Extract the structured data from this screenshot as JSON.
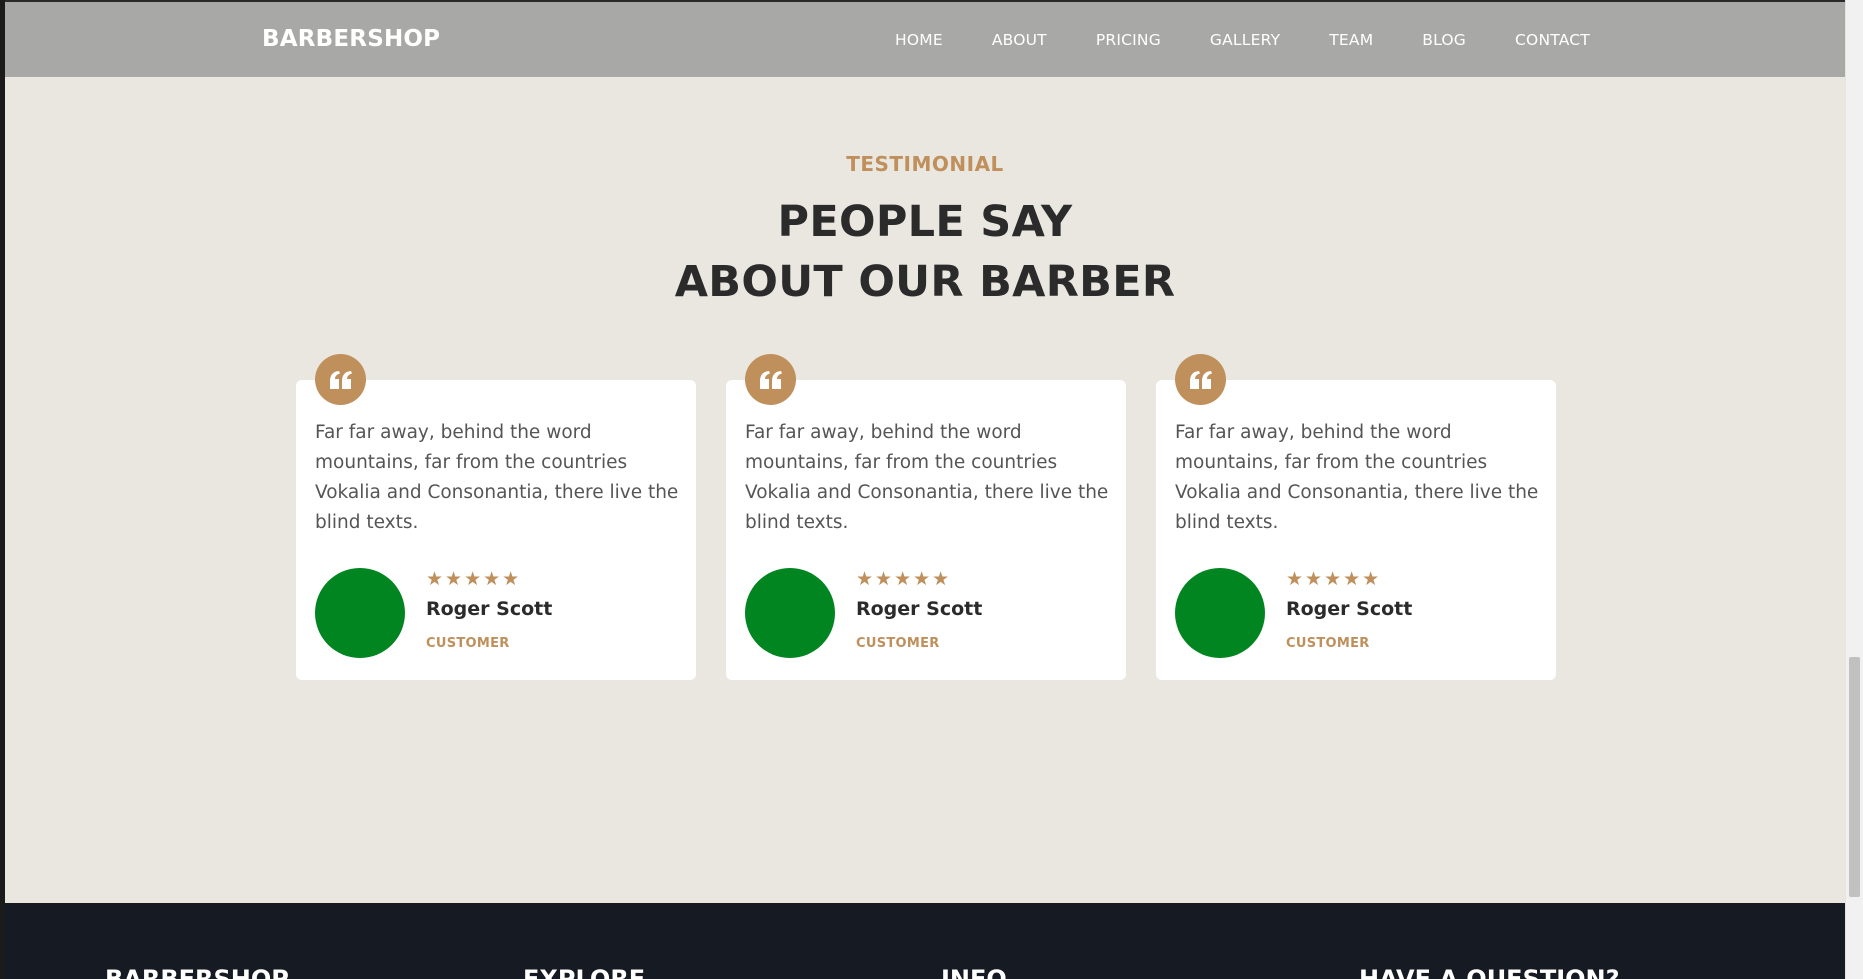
{
  "navbar": {
    "brand": "BARBERSHOP",
    "items": [
      "HOME",
      "ABOUT",
      "PRICING",
      "GALLERY",
      "TEAM",
      "BLOG",
      "CONTACT"
    ]
  },
  "testimonial": {
    "subheading": "TESTIMONIAL",
    "heading_line1": "PEOPLE SAY",
    "heading_line2": "ABOUT OUR BARBER",
    "cards": [
      {
        "text": "Far far away, behind the word mountains, far from the countries Vokalia and Consonantia, there live the blind texts.",
        "stars": "★★★★★",
        "name": "Roger Scott",
        "role": "CUSTOMER"
      },
      {
        "text": "Far far away, behind the word mountains, far from the countries Vokalia and Consonantia, there live the blind texts.",
        "stars": "★★★★★",
        "name": "Roger Scott",
        "role": "CUSTOMER"
      },
      {
        "text": "Far far away, behind the word mountains, far from the countries Vokalia and Consonantia, there live the blind texts.",
        "stars": "★★★★★",
        "name": "Roger Scott",
        "role": "CUSTOMER"
      }
    ]
  },
  "footer": {
    "columns": [
      "BARBERSHOP",
      "EXPLORE",
      "INFO",
      "HAVE A QUESTION?"
    ]
  },
  "colors": {
    "accent": "#bf8f5c",
    "nav_bg": "#a8a8a6",
    "page_bg": "#eae7e0",
    "footer_bg": "#161a22",
    "avatar": "#008520"
  },
  "icons": {
    "quote": "quote-icon",
    "star": "star-icon"
  }
}
